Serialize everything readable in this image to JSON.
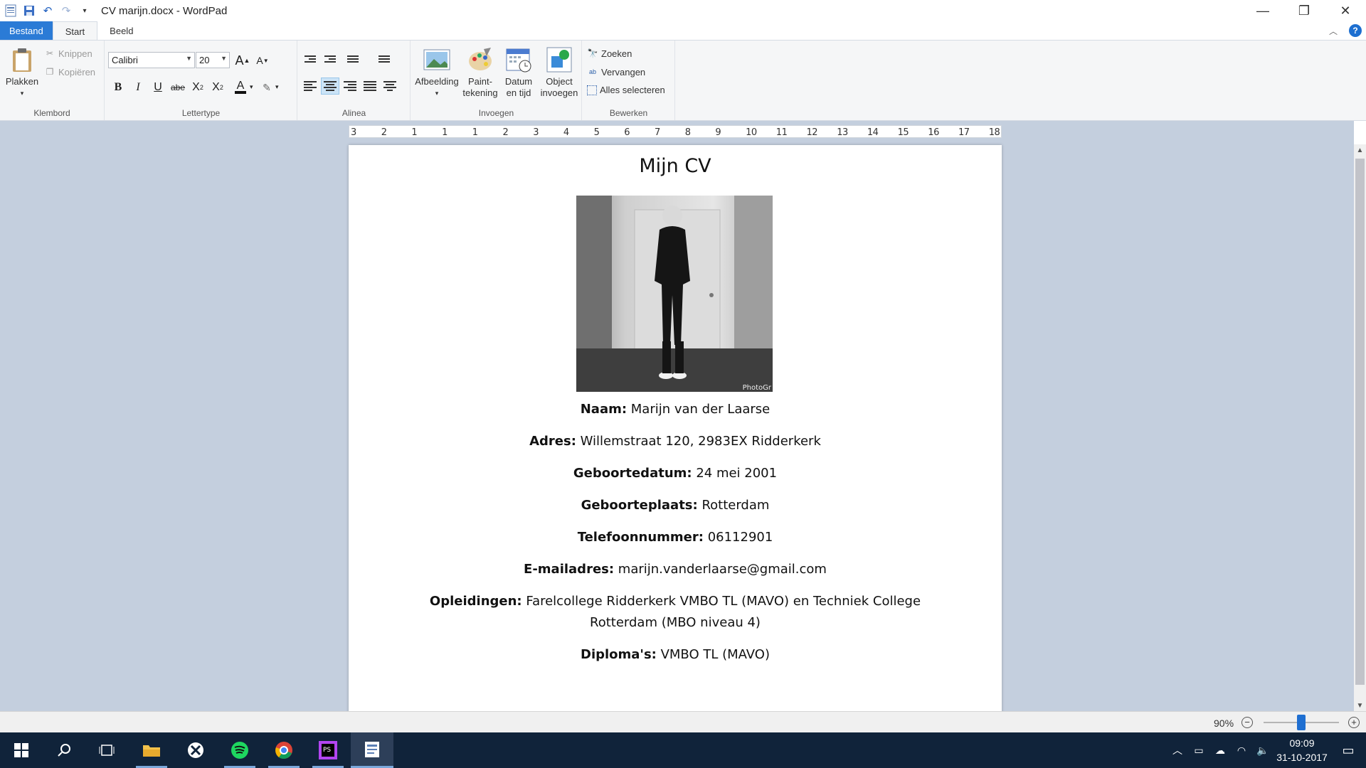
{
  "window": {
    "title": "CV marijn.docx - WordPad",
    "minimize": "—",
    "restore": "❐",
    "close": "✕"
  },
  "tabs": [
    "Bestand",
    "Start",
    "Beeld"
  ],
  "ribbon": {
    "clipboard": {
      "paste": "Plakken",
      "cut": "Knippen",
      "copy": "Kopiëren",
      "label": "Klembord"
    },
    "font": {
      "family": "Calibri",
      "size": "20",
      "label": "Lettertype"
    },
    "paragraph": {
      "label": "Alinea"
    },
    "insert": {
      "picture": "Afbeelding",
      "paint_1": "Paint-",
      "paint_2": "tekening",
      "datetime_1": "Datum",
      "datetime_2": "en tijd",
      "object_1": "Object",
      "object_2": "invoegen",
      "label": "Invoegen"
    },
    "edit": {
      "find": "Zoeken",
      "replace": "Vervangen",
      "select_all": "Alles selecteren",
      "label": "Bewerken"
    }
  },
  "ruler": [
    "3",
    "2",
    "1",
    "1",
    "1",
    "2",
    "3",
    "4",
    "5",
    "6",
    "7",
    "8",
    "9",
    "10",
    "11",
    "12",
    "13",
    "14",
    "15",
    "16",
    "17",
    "18"
  ],
  "document": {
    "title": "Mijn CV",
    "photo_watermark": "PhotoGr",
    "fields": [
      {
        "label": "Naam:",
        "value": " Marijn van der Laarse"
      },
      {
        "label": "Adres:",
        "value": " Willemstraat 120, 2983EX Ridderkerk"
      },
      {
        "label": "Geboortedatum:",
        "value": " 24 mei 2001"
      },
      {
        "label": "Geboorteplaats:",
        "value": " Rotterdam"
      },
      {
        "label": "Telefoonnummer:",
        "value": " 06112901"
      },
      {
        "label": "E-mailadres:",
        "value": " marijn.vanderlaarse@gmail.com"
      },
      {
        "label": "Opleidingen:",
        "value": " Farelcollege Ridderkerk VMBO TL (MAVO) en Techniek College",
        "value2": "Rotterdam (MBO niveau 4)"
      },
      {
        "label": "Diploma's:",
        "value": " VMBO TL (MAVO)"
      }
    ]
  },
  "status": {
    "zoom": "90%",
    "zoom_fraction": 0.5
  },
  "taskbar": {
    "time": "09:09",
    "date": "31-10-2017"
  },
  "colors": {
    "accent": "#2b7bd6",
    "taskbar": "#10233a",
    "workspace": "#c4cfde"
  }
}
